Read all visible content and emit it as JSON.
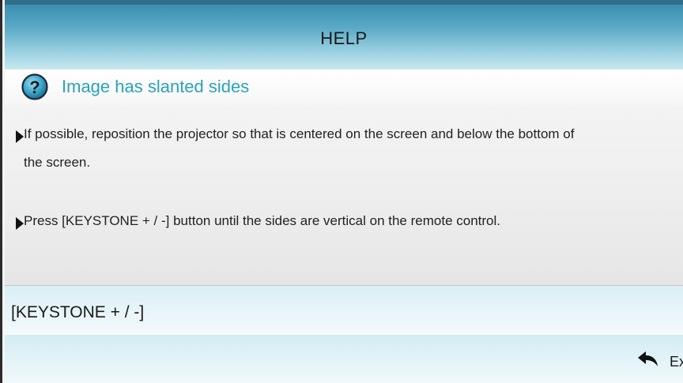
{
  "header": {
    "title": "HELP"
  },
  "topic": {
    "icon": "question-icon",
    "text": "Image has slanted sides",
    "color": "#2aa3ba"
  },
  "content": {
    "bullets": [
      {
        "text": "If possible, reposition the projector so that is centered on the screen and below the bottom of the screen."
      },
      {
        "text": "Press [KEYSTONE + / -] button until the sides are vertical on the remote control."
      }
    ]
  },
  "keystone": {
    "label": "[KEYSTONE + / -]"
  },
  "footer": {
    "exit_icon": "return-arrow-icon",
    "exit_label": "Exit"
  }
}
